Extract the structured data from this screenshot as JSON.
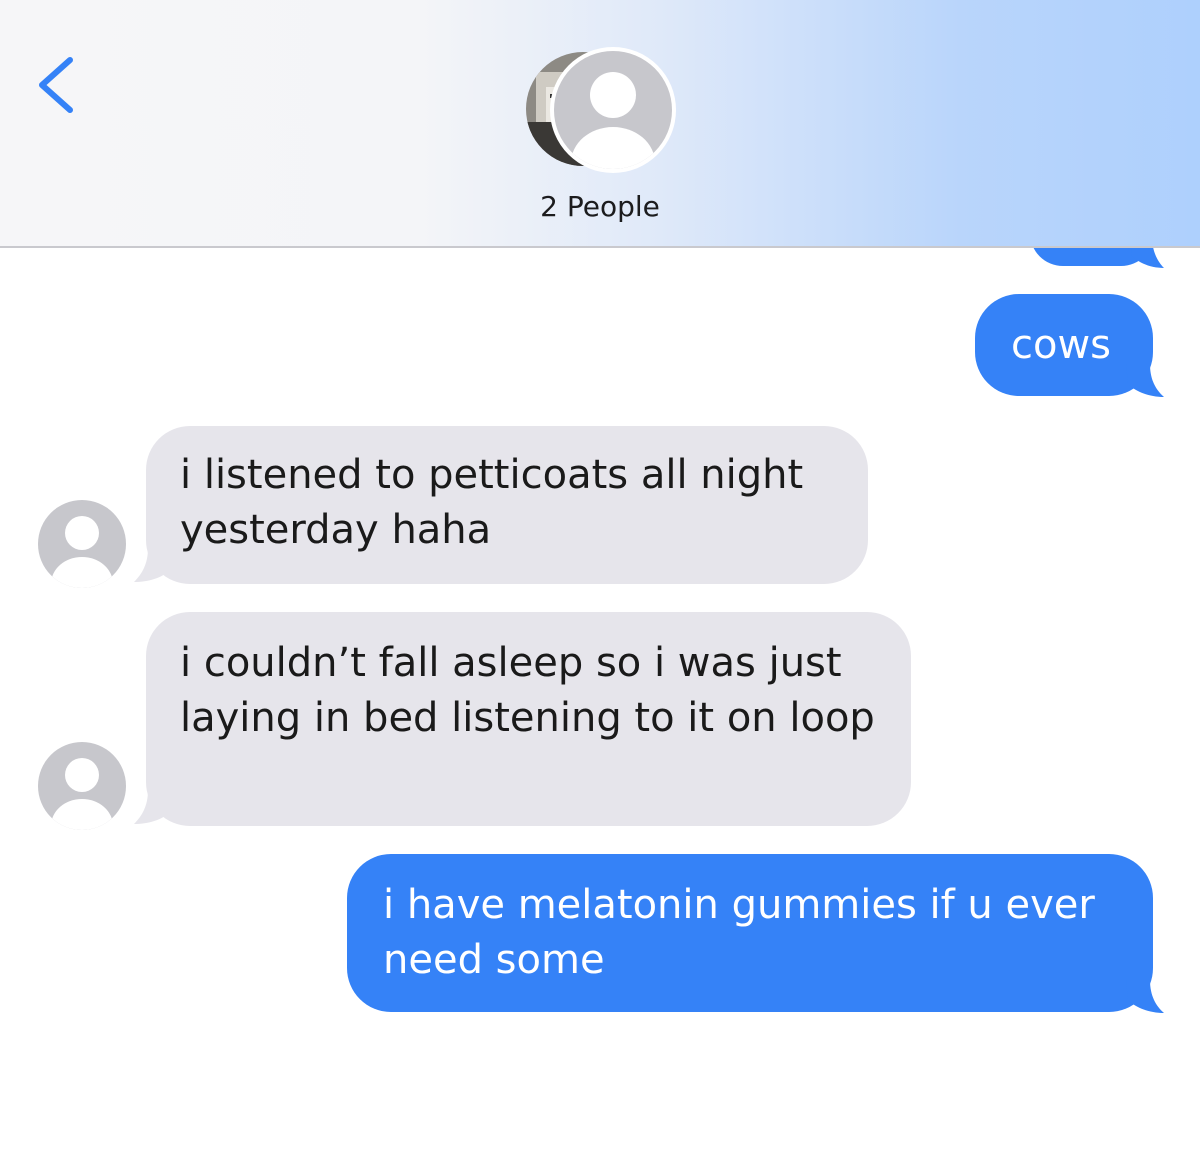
{
  "header": {
    "title": "2 People",
    "back_icon": "chevron-left-icon",
    "accent_color": "#3582f7"
  },
  "messages": [
    {
      "direction": "sent",
      "text": "cows"
    },
    {
      "direction": "received",
      "text": "i listened to petticoats all night yesterday haha"
    },
    {
      "direction": "received",
      "text": "i couldn’t fall asleep so i was just laying in bed listening to it on loop"
    },
    {
      "direction": "sent",
      "text": "i have melatonin gummies if u ever need some"
    }
  ],
  "colors": {
    "sent_bubble": "#3582f7",
    "received_bubble": "#e6e5eb",
    "placeholder_avatar": "#c7c7cc"
  }
}
